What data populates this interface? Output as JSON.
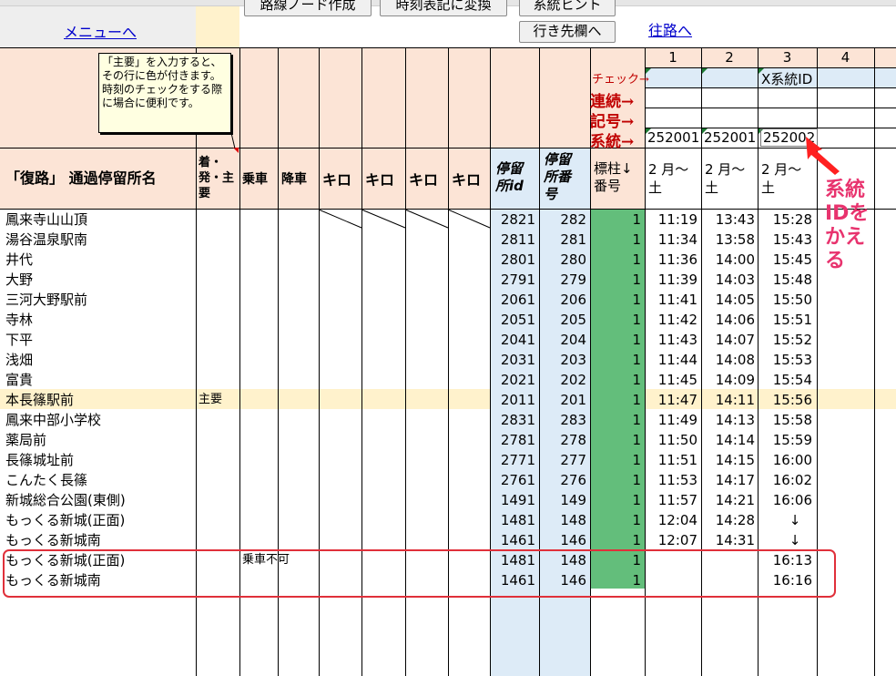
{
  "top": {
    "menu_link": "メニューへ",
    "btn_route_cut": "路線ノード作成",
    "btn_timetable_cut": "時刻表記に変換",
    "btn_system_cut": "系統ヒント",
    "btn_destination": "行き先欄へ",
    "forward_link": "往路へ"
  },
  "tooltip": {
    "text": "「主要」を入力すると、その行に色が付きます。時刻のチェックをする際に場合に便利です。"
  },
  "col_numbers": [
    "1",
    "2",
    "3",
    "4"
  ],
  "labels": {
    "check": "チェック→",
    "renzoku": "連続→",
    "kigou": "記号→",
    "keito": "系統→"
  },
  "x_system_id": "X系統ID",
  "system_ids": [
    "252001",
    "252001",
    "252002"
  ],
  "headers": {
    "stop_name": "「復路」 通過停留所名",
    "arr_dep": "着・発・主要",
    "board": "乗車",
    "alight": "降車",
    "km1": "キロ",
    "km2": "キロ",
    "km3": "キロ",
    "km4": "キロ",
    "stop_id": "停留所id",
    "stop_num": "停留所番号",
    "pole": "標柱↓番号",
    "trip1": "2 月〜土",
    "trip2": "2 月〜土",
    "trip3": "2 月〜土"
  },
  "annotation": {
    "text": "系統IDをかえる",
    "color": "#e8336e"
  },
  "rows": [
    {
      "name": "鳳来寺山山頂",
      "main": "",
      "board": "",
      "id": "2821",
      "num": "282",
      "pole": "1",
      "t1": "11:19",
      "t2": "13:43",
      "t3": "15:28"
    },
    {
      "name": "湯谷温泉駅南",
      "main": "",
      "board": "",
      "id": "2811",
      "num": "281",
      "pole": "1",
      "t1": "11:34",
      "t2": "13:58",
      "t3": "15:43"
    },
    {
      "name": "井代",
      "main": "",
      "board": "",
      "id": "2801",
      "num": "280",
      "pole": "1",
      "t1": "11:36",
      "t2": "14:00",
      "t3": "15:45"
    },
    {
      "name": "大野",
      "main": "",
      "board": "",
      "id": "2791",
      "num": "279",
      "pole": "1",
      "t1": "11:39",
      "t2": "14:03",
      "t3": "15:48"
    },
    {
      "name": "三河大野駅前",
      "main": "",
      "board": "",
      "id": "2061",
      "num": "206",
      "pole": "1",
      "t1": "11:41",
      "t2": "14:05",
      "t3": "15:50"
    },
    {
      "name": "寺林",
      "main": "",
      "board": "",
      "id": "2051",
      "num": "205",
      "pole": "1",
      "t1": "11:42",
      "t2": "14:06",
      "t3": "15:51"
    },
    {
      "name": "下平",
      "main": "",
      "board": "",
      "id": "2041",
      "num": "204",
      "pole": "1",
      "t1": "11:43",
      "t2": "14:07",
      "t3": "15:52"
    },
    {
      "name": "浅畑",
      "main": "",
      "board": "",
      "id": "2031",
      "num": "203",
      "pole": "1",
      "t1": "11:44",
      "t2": "14:08",
      "t3": "15:53"
    },
    {
      "name": "富貴",
      "main": "",
      "board": "",
      "id": "2021",
      "num": "202",
      "pole": "1",
      "t1": "11:45",
      "t2": "14:09",
      "t3": "15:54"
    },
    {
      "name": "本長篠駅前",
      "main": "主要",
      "board": "",
      "id": "2011",
      "num": "201",
      "pole": "1",
      "t1": "11:47",
      "t2": "14:11",
      "t3": "15:56"
    },
    {
      "name": "鳳来中部小学校",
      "main": "",
      "board": "",
      "id": "2831",
      "num": "283",
      "pole": "1",
      "t1": "11:49",
      "t2": "14:13",
      "t3": "15:58"
    },
    {
      "name": "薬局前",
      "main": "",
      "board": "",
      "id": "2781",
      "num": "278",
      "pole": "1",
      "t1": "11:50",
      "t2": "14:14",
      "t3": "15:59"
    },
    {
      "name": "長篠城址前",
      "main": "",
      "board": "",
      "id": "2771",
      "num": "277",
      "pole": "1",
      "t1": "11:51",
      "t2": "14:15",
      "t3": "16:00"
    },
    {
      "name": "こんたく長篠",
      "main": "",
      "board": "",
      "id": "2761",
      "num": "276",
      "pole": "1",
      "t1": "11:53",
      "t2": "14:17",
      "t3": "16:02"
    },
    {
      "name": "新城総合公園(東側)",
      "main": "",
      "board": "",
      "id": "1491",
      "num": "149",
      "pole": "1",
      "t1": "11:57",
      "t2": "14:21",
      "t3": "16:06"
    },
    {
      "name": "もっくる新城(正面)",
      "main": "",
      "board": "",
      "id": "1481",
      "num": "148",
      "pole": "1",
      "t1": "12:04",
      "t2": "14:28",
      "t3": "↓"
    },
    {
      "name": "もっくる新城南",
      "main": "",
      "board": "",
      "id": "1461",
      "num": "146",
      "pole": "1",
      "t1": "12:07",
      "t2": "14:31",
      "t3": "↓"
    },
    {
      "name": "もっくる新城(正面)",
      "main": "",
      "board": "乗車不可",
      "id": "1481",
      "num": "148",
      "pole": "1",
      "t1": "",
      "t2": "",
      "t3": "16:13"
    },
    {
      "name": "もっくる新城南",
      "main": "",
      "board": "",
      "id": "1461",
      "num": "146",
      "pole": "1",
      "t1": "",
      "t2": "",
      "t3": "16:16"
    }
  ]
}
